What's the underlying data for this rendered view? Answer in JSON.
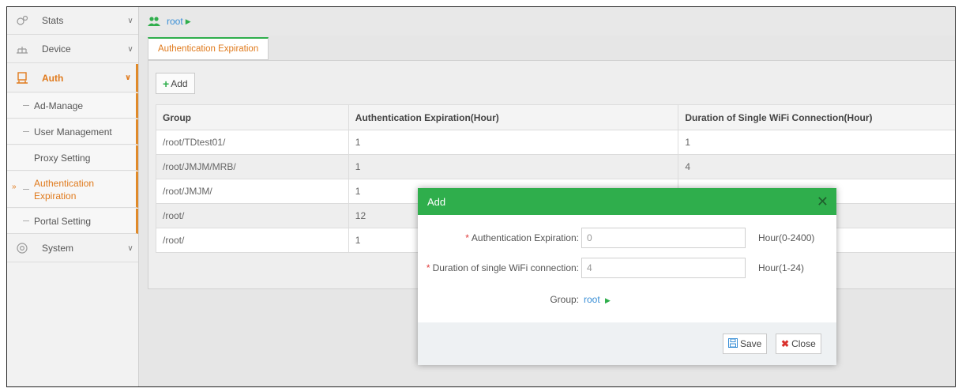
{
  "sidebar": {
    "items": [
      {
        "label": "Stats",
        "icon": "stats-icon"
      },
      {
        "label": "Device",
        "icon": "device-icon"
      },
      {
        "label": "Auth",
        "icon": "auth-icon"
      },
      {
        "label": "System",
        "icon": "gear-icon"
      }
    ],
    "auth_sub": [
      {
        "label": "Ad-Manage"
      },
      {
        "label": "User Management"
      },
      {
        "label": "Proxy Setting"
      },
      {
        "label": "Authentication Expiration"
      },
      {
        "label": "Portal Setting"
      }
    ],
    "current_marker": "»"
  },
  "breadcrumb": {
    "label": "root"
  },
  "tabs": [
    {
      "label": "Authentication Expiration"
    }
  ],
  "toolbar": {
    "add_label": "Add"
  },
  "table": {
    "headers": [
      "Group",
      "Authentication Expiration(Hour)",
      "Duration of Single WiFi Connection(Hour)"
    ],
    "rows": [
      [
        "/root/TDtest01/",
        "1",
        "1"
      ],
      [
        "/root/JMJM/MRB/",
        "1",
        "4"
      ],
      [
        "/root/JMJM/",
        "1",
        ""
      ],
      [
        "/root/",
        "12",
        ""
      ],
      [
        "/root/",
        "1",
        ""
      ]
    ]
  },
  "dialog": {
    "title": "Add",
    "fields": [
      {
        "label": "Authentication Expiration:",
        "value": "0",
        "hint": "Hour(0-2400)"
      },
      {
        "label": "Duration of single WiFi connection:",
        "value": "4",
        "hint": "Hour(1-24)"
      }
    ],
    "group_label": "Group:",
    "group_value": "root",
    "save_label": "Save",
    "close_label": "Close"
  },
  "colors": {
    "accent_green": "#2fae4c",
    "accent_orange": "#e07a1c",
    "link_blue": "#3a8fd6"
  }
}
